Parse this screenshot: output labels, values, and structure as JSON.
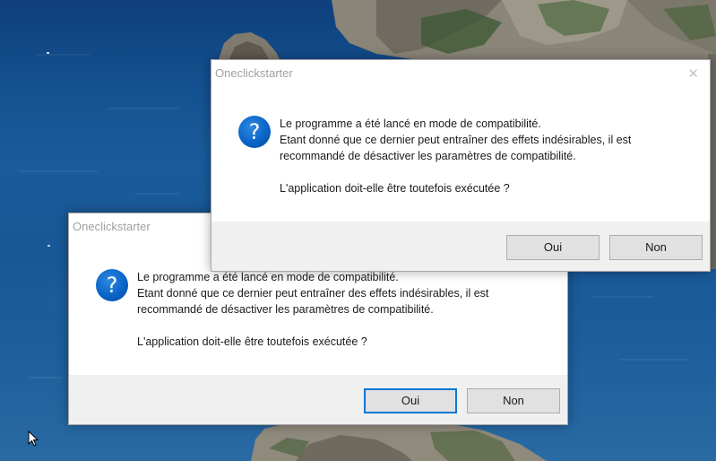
{
  "dialogs": {
    "back": {
      "title": "Oneclickstarter",
      "close": "✕",
      "line1": "Le programme a été lancé en mode de compatibilité.",
      "line2": "Etant donné que ce dernier peut entraîner des effets indésirables, il est",
      "line3": "recommandé de désactiver les paramètres de compatibilité.",
      "question": "L'application doit-elle être toutefois exécutée ?",
      "yes": "Oui",
      "no": "Non"
    },
    "front": {
      "title": "Oneclickstarter",
      "close": "✕",
      "line1": "Le programme a été lancé en mode de compatibilité.",
      "line2": "Etant donné que ce dernier peut entraîner des effets indésirables, il est",
      "line3": "recommandé de désactiver les paramètres de compatibilité.",
      "question": "L'application doit-elle être toutefois exécutée ?",
      "yes": "Oui",
      "no": "Non"
    }
  },
  "icons": {
    "question": "?"
  }
}
